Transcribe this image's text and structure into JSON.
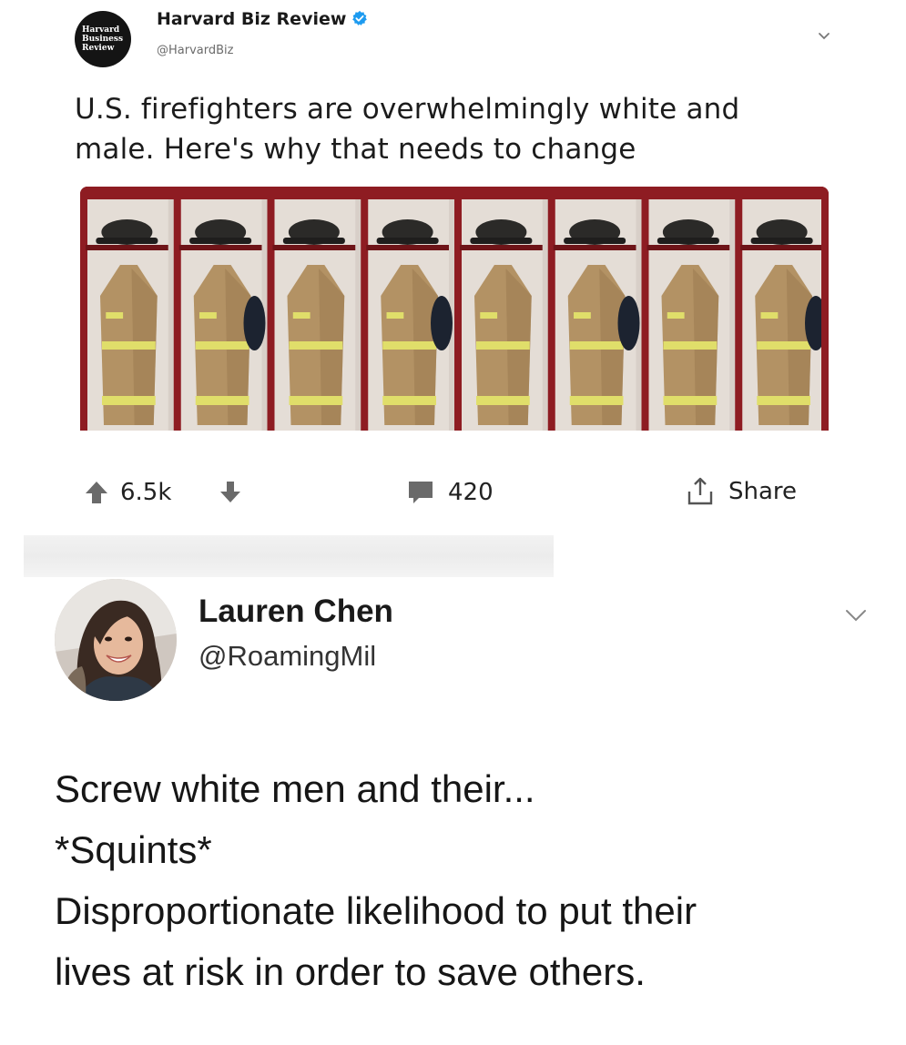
{
  "post1": {
    "logo_lines": [
      "Harvard",
      "Business",
      "Review"
    ],
    "name": "Harvard Biz Review",
    "handle": "@HarvardBiz",
    "verified": true,
    "text_line1": "U.S. firefighters are overwhelmingly white and",
    "text_line2": "male. Here's why that needs to change",
    "image_icon": "firefighter-gear-lockers-photo",
    "upvotes": "6.5k",
    "comments": "420",
    "share_label": "Share",
    "colors": {
      "locker_red": "#8e1c22",
      "gear_tan": "#b39264",
      "reflective_yellow": "#e0de6a",
      "verified_blue": "#1d9bf0"
    }
  },
  "post2": {
    "name": "Lauren Chen",
    "handle": "@RoamingMil",
    "avatar_icon": "profile-photo",
    "body_lines": [
      "Screw white men and their...",
      "*Squints*",
      "Disproportionate likelihood to put their",
      "lives at risk in order to save others."
    ]
  }
}
